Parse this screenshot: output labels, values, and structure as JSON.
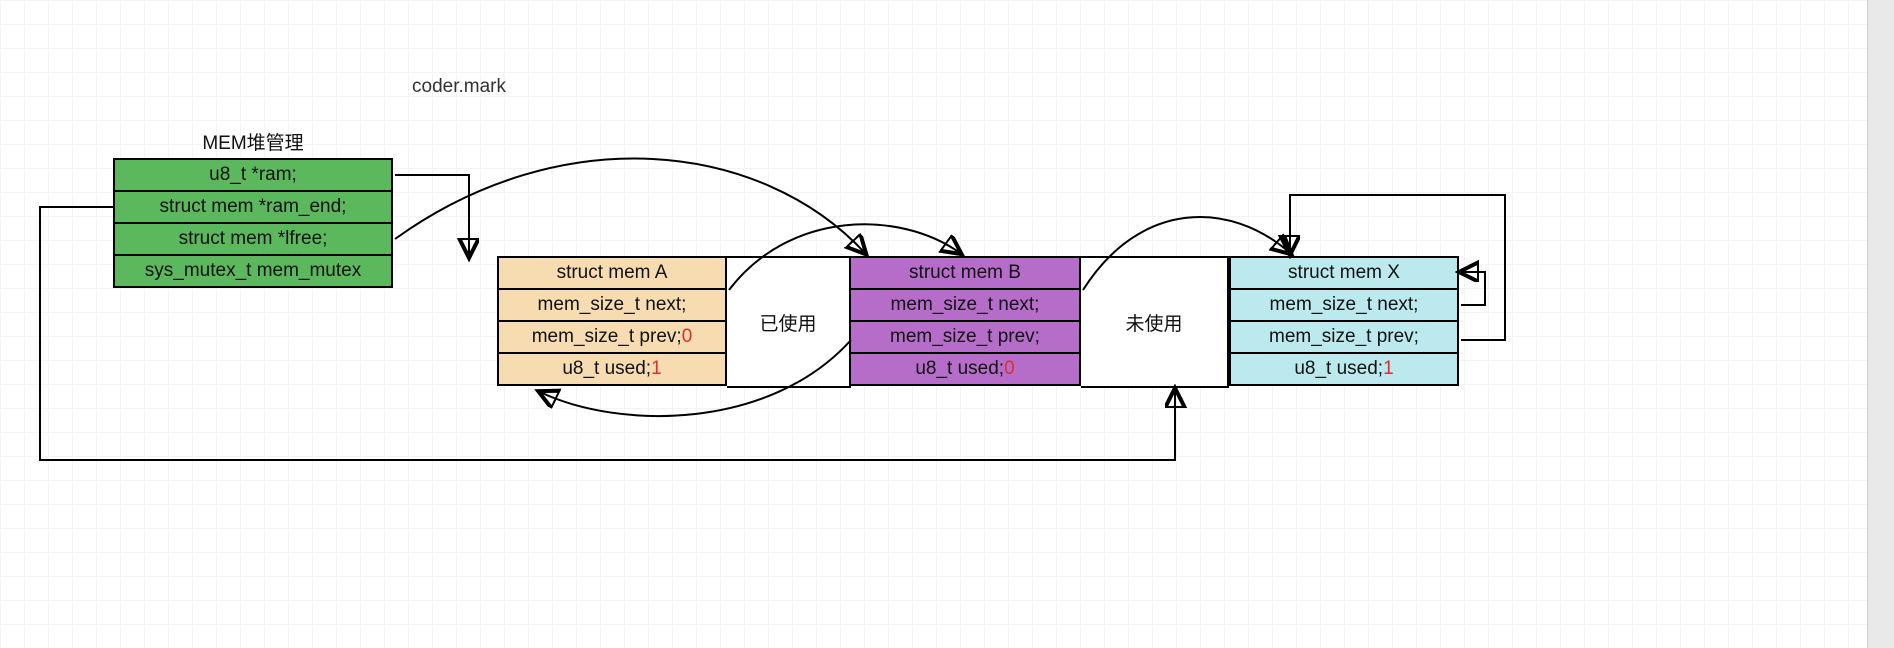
{
  "watermark": "coder.mark",
  "manager": {
    "title": "MEM堆管理",
    "rows": [
      "u8_t *ram;",
      "struct mem *ram_end;",
      "struct mem *lfree;",
      "sys_mutex_t mem_mutex"
    ]
  },
  "blockA": {
    "title": "struct mem A",
    "next": "mem_size_t next;",
    "prev": "mem_size_t prev;",
    "prev_val": "0",
    "used": "u8_t used;",
    "used_val": "1",
    "side_label": "已使用"
  },
  "blockB": {
    "title": "struct mem B",
    "next": "mem_size_t next;",
    "prev": "mem_size_t prev;",
    "used": "u8_t used;",
    "used_val": "0",
    "side_label": "未使用"
  },
  "blockX": {
    "title": "struct mem X",
    "next": "mem_size_t next;",
    "prev": "mem_size_t prev;",
    "used": "u8_t used;",
    "used_val": "1"
  },
  "colors": {
    "green": "#5cb85c",
    "tan": "#f6dcb0",
    "purple": "#b66dca",
    "cyan": "#bce9ee",
    "red": "#d9302d"
  }
}
